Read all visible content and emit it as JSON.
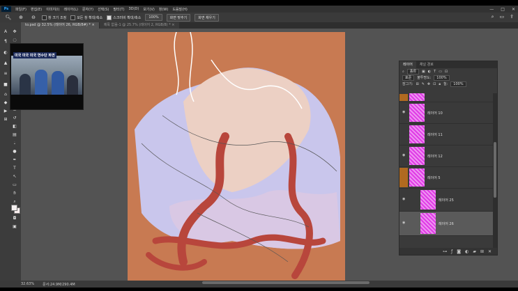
{
  "app": {
    "logo": "Ps"
  },
  "menu": [
    "파일(F)",
    "편집(E)",
    "이미지(I)",
    "레이어(L)",
    "문자(Y)",
    "선택(S)",
    "필터(T)",
    "3D(D)",
    "보기(V)",
    "창(W)",
    "도움말(H)"
  ],
  "window_controls": {
    "minimize": "—",
    "maximize": "□",
    "close": "✕"
  },
  "options_bar": {
    "fit_windows": "창 크기 조정",
    "zoom_all": "모든 창 확대/축소",
    "scrubby_zoom": "스크러비 확대/축소",
    "zoom_value": "100%",
    "fit_screen": "화면 맞추기",
    "fill_screen": "화면 채우기"
  },
  "tabs": [
    {
      "label": "to.psd @ 32.5% (레이어 26, RGB/8#) *",
      "close": "×",
      "active": true
    },
    {
      "label": "제목 없음-1 @ 25.7% (레이어 2, RGB/8) *",
      "close": "×",
      "active": false
    }
  ],
  "video": {
    "caption": "미국 미국 미국 연수단 파견"
  },
  "layers_panel": {
    "tabs": [
      "레이어",
      "채널 경로"
    ],
    "filter_label": "종류",
    "blend_mode": "표준",
    "opacity_label": "불투명도:",
    "opacity_value": "100%",
    "lock_label": "잠그기:",
    "fill_label": "칠:",
    "fill_value": "100%",
    "layers": [
      {
        "name": "",
        "visible": false,
        "marked": true
      },
      {
        "name": "레이어 10",
        "visible": true,
        "marked": false
      },
      {
        "name": "레이어 11",
        "visible": false,
        "marked": false
      },
      {
        "name": "레이어 12",
        "visible": true,
        "marked": false
      },
      {
        "name": "레이어 5",
        "visible": false,
        "marked": true
      },
      {
        "name": "레이어 25",
        "visible": true,
        "marked": false
      },
      {
        "name": "레이어 26",
        "visible": true,
        "marked": false
      }
    ]
  },
  "status": {
    "zoom": "32.63%",
    "doc_size": "문서:24.9M/290.4M"
  },
  "colors": {
    "canvas_bg": "#c87a52",
    "layer_thumb": "#e03be6",
    "layer_mark": "#b06a20",
    "red_stroke": "#b8463c",
    "lavender": "#c9c6ec",
    "skin_light": "#ecd0c4"
  }
}
